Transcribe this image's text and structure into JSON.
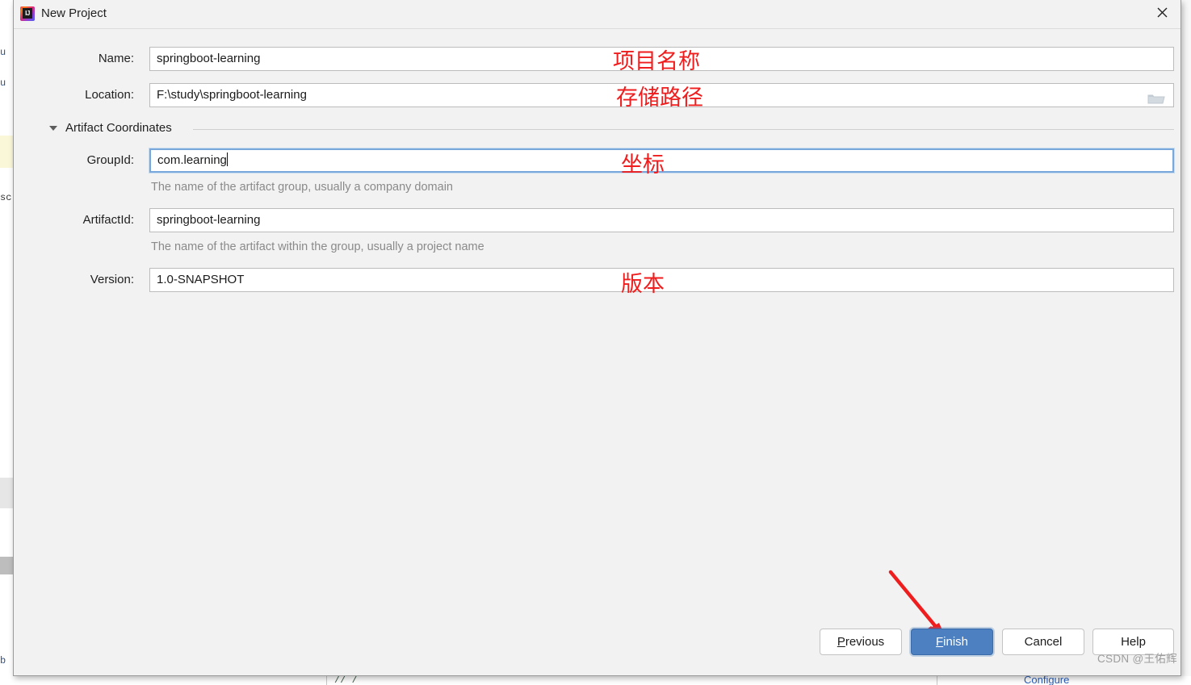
{
  "window": {
    "title": "New Project",
    "app_icon": "intellij-idea-icon",
    "close_icon": "close-icon"
  },
  "form": {
    "name": {
      "label": "Name:",
      "value": "springboot-learning",
      "placeholder": ""
    },
    "location": {
      "label": "Location:",
      "value": "F:\\study\\springboot-learning",
      "placeholder": "",
      "browse_icon": "folder-icon"
    },
    "section": {
      "label": "Artifact Coordinates",
      "expander_icon": "chevron-down-icon"
    },
    "group_id": {
      "label": "GroupId:",
      "value": "com.learning",
      "hint": "The name of the artifact group, usually a company domain",
      "focused": true
    },
    "artifact_id": {
      "label": "ArtifactId:",
      "value": "springboot-learning",
      "hint": "The name of the artifact within the group, usually a project name"
    },
    "version": {
      "label": "Version:",
      "value": "1.0-SNAPSHOT",
      "hint": ""
    }
  },
  "annotations": {
    "name": "项目名称",
    "location": "存储路径",
    "coordinates": "坐标",
    "version": "版本",
    "arrow_color": "#ef1d1d"
  },
  "buttons": {
    "previous": {
      "pre": "P",
      "mnemonic": "P",
      "post": "revious"
    },
    "finish": {
      "pre": "",
      "mnemonic": "F",
      "post": "inish",
      "primary": true
    },
    "cancel": {
      "label": "Cancel"
    },
    "help": {
      "label": "Help"
    }
  },
  "background": {
    "configure_link": "Configure",
    "left_fragments": [
      "u",
      "u",
      "sc",
      "b"
    ]
  },
  "watermark": "CSDN @王佑辉",
  "colors": {
    "accent": "#4d80c0",
    "focus_border": "#7aa8dc",
    "annotation_red": "#ef1d1d",
    "dialog_bg": "#f2f2f2",
    "hint_gray": "#8a8a8a"
  }
}
